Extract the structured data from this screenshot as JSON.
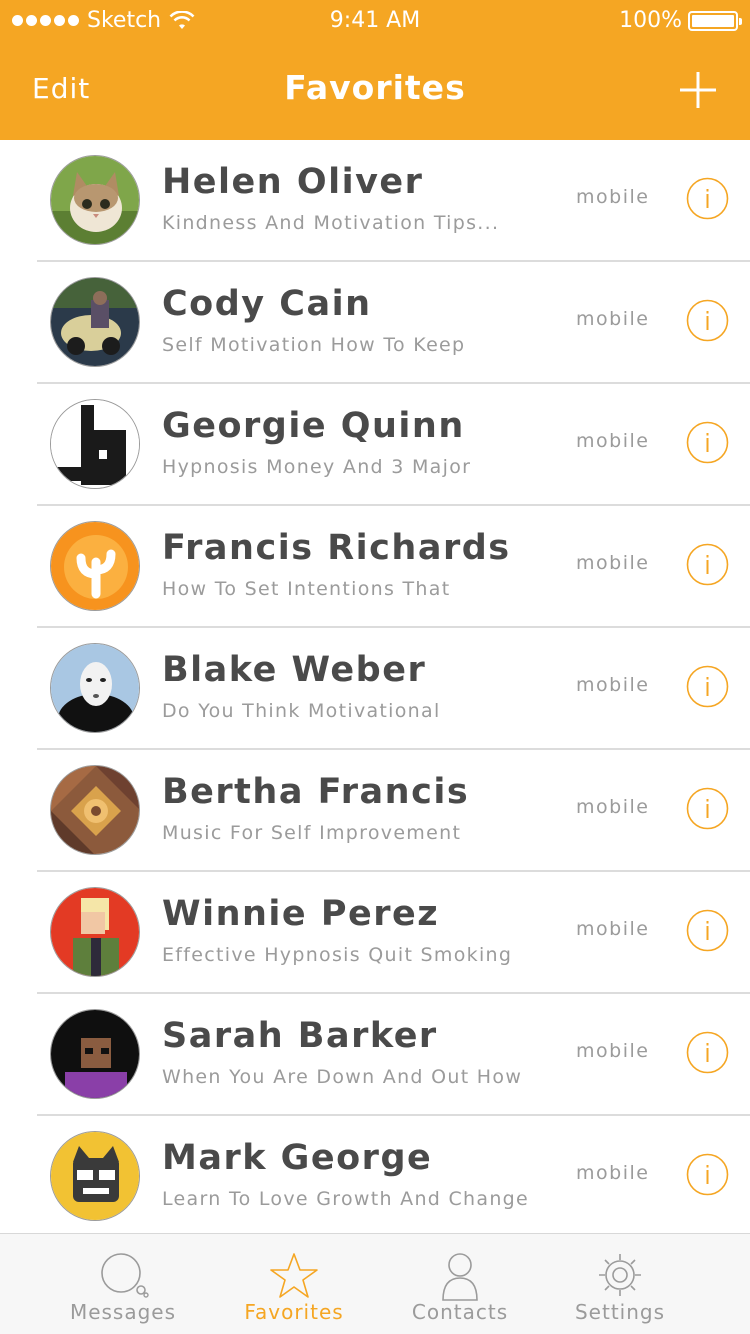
{
  "status": {
    "carrier": "Sketch",
    "time": "9:41 AM",
    "battery": "100%"
  },
  "nav": {
    "edit_label": "Edit",
    "title": "Favorites"
  },
  "contacts": [
    {
      "name": "Helen Oliver",
      "subtitle": "Kindness And Motivation Tips...",
      "type": "mobile"
    },
    {
      "name": "Cody Cain",
      "subtitle": "Self Motivation How To Keep",
      "type": "mobile"
    },
    {
      "name": "Georgie Quinn",
      "subtitle": "Hypnosis Money And 3 Major",
      "type": "mobile"
    },
    {
      "name": "Francis Richards",
      "subtitle": "How To Set Intentions That",
      "type": "mobile"
    },
    {
      "name": "Blake Weber",
      "subtitle": "Do You Think Motivational",
      "type": "mobile"
    },
    {
      "name": "Bertha Francis",
      "subtitle": "Music For Self Improvement",
      "type": "mobile"
    },
    {
      "name": "Winnie Perez",
      "subtitle": "Effective Hypnosis Quit Smoking",
      "type": "mobile"
    },
    {
      "name": "Sarah Barker",
      "subtitle": "When You Are Down And Out How",
      "type": "mobile"
    },
    {
      "name": "Mark George",
      "subtitle": "Learn To Love Growth And Change",
      "type": "mobile"
    }
  ],
  "tabs": [
    {
      "label": "Messages",
      "icon": "chat-bubble-icon",
      "active": false
    },
    {
      "label": "Favorites",
      "icon": "star-icon",
      "active": true
    },
    {
      "label": "Contacts",
      "icon": "person-icon",
      "active": false
    },
    {
      "label": "Settings",
      "icon": "gear-icon",
      "active": false
    }
  ],
  "colors": {
    "accent": "#F5A623",
    "text_dark": "#4A4A4A",
    "text_muted": "#9B9B9B",
    "separator": "#DCDCDC"
  }
}
